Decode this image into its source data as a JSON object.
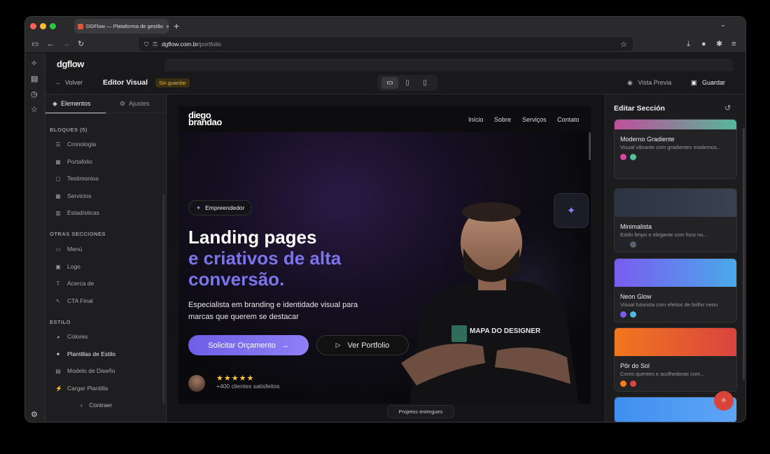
{
  "browser": {
    "tab_title": "DGFlow — Plataforma de gestão",
    "url_host": "dgflow.com.br",
    "url_path": "/portfolio"
  },
  "app": {
    "bg_logo": "dgflow",
    "back_label": "Volver",
    "editor_title": "Editor Visual",
    "unsaved_badge": "Sin guardar",
    "preview_label": "Vista Previa",
    "save_label": "Guardar"
  },
  "leftpanel": {
    "tab_elements": "Elementos",
    "tab_settings": "Ajustes",
    "blocks_heading": "BLOQUES (5)",
    "blocks": [
      {
        "label": "Cronologia",
        "icon": "list-icon"
      },
      {
        "label": "Portafolio",
        "icon": "grid-icon"
      },
      {
        "label": "Testimonios",
        "icon": "chat-icon"
      },
      {
        "label": "Servicios",
        "icon": "table-icon"
      },
      {
        "label": "Estadísticas",
        "icon": "chart-icon"
      }
    ],
    "other_heading": "OTRAS SECCIONES",
    "other": [
      {
        "label": "Menú",
        "icon": "menu-icon"
      },
      {
        "label": "Logo",
        "icon": "image-icon"
      },
      {
        "label": "Acerca de",
        "icon": "text-icon"
      },
      {
        "label": "CTA Final",
        "icon": "cursor-icon"
      }
    ],
    "style_heading": "ESTILO",
    "style": [
      {
        "label": "Colores",
        "icon": "palette-icon"
      },
      {
        "label": "Plantillas de Estilo",
        "icon": "sparkle-icon"
      },
      {
        "label": "Modelo de Diseño",
        "icon": "layout-icon"
      },
      {
        "label": "Cargar Plantilla",
        "icon": "magic-icon"
      }
    ],
    "collapse_label": "Contraer"
  },
  "site": {
    "logo_line1": "diego",
    "logo_line2": "brandao",
    "nav": [
      "Início",
      "Sobre",
      "Serviços",
      "Contato"
    ],
    "badge": "Empreendedor",
    "headline1": "Landing pages",
    "headline2": "e criativos de alta",
    "headline3": "conversão.",
    "lead": "Especialista em branding e identidade visual para marcas que querem se destacar",
    "cta_primary": "Solicitar Orçamento",
    "cta_secondary": "Ver Portfolio",
    "stars": "★★★★★",
    "clients": "+400 clientes satisfeitos",
    "shirt_text": "MAPA DO DESIGNER",
    "floating_label": "Projetos entregues"
  },
  "rightpanel": {
    "title": "Editar Sección",
    "cards": [
      {
        "name": "Moderno Gradiente",
        "desc": "Visual vibrante com gradientes modernos...",
        "gradient": [
          "#c04f9b",
          "#55b79a"
        ],
        "swatches": [
          "#d846a3",
          "#4fc39e"
        ]
      },
      {
        "name": "Minimalista",
        "desc": "Estilo limpo e elegante com foco no...",
        "gradient": [
          "#2c3342",
          "#3a4150"
        ],
        "swatches": [
          "#1e2433",
          "#5a6070"
        ]
      },
      {
        "name": "Neon Glow",
        "desc": "Visual futurista com efeitos de brilho neon",
        "gradient": [
          "#7a5cf0",
          "#4aa9e9"
        ],
        "swatches": [
          "#7a5cf0",
          "#4fb7e0"
        ]
      },
      {
        "name": "Pôr do Sol",
        "desc": "Cores quentes e acolhedoras com...",
        "gradient": [
          "#f2771e",
          "#d9443f"
        ],
        "swatches": [
          "#f27d20",
          "#de4343"
        ]
      },
      {
        "name": "",
        "desc": "",
        "gradient": [
          "#3f8ff0",
          "#5fa5f5"
        ],
        "swatches": []
      }
    ]
  }
}
